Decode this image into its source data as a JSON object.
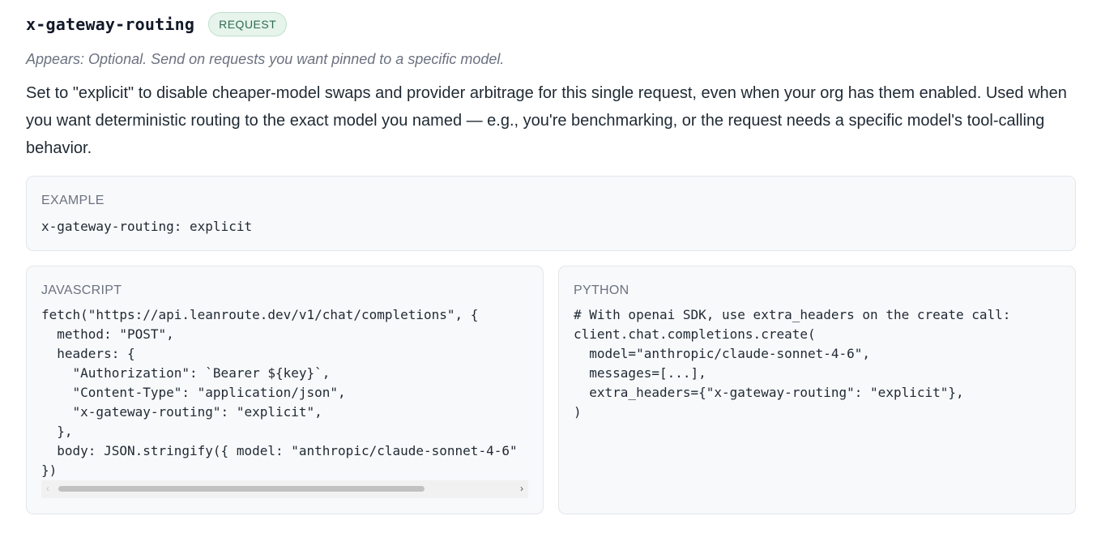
{
  "header": {
    "name": "x-gateway-routing",
    "badge": "REQUEST"
  },
  "appears": "Appears: Optional. Send on requests you want pinned to a specific model.",
  "description": "Set to \"explicit\" to disable cheaper-model swaps and provider arbitrage for this single request, even when your org has them enabled. Used when you want deterministic routing to the exact model you named — e.g., you're benchmarking, or the request needs a specific model's tool-calling behavior.",
  "example": {
    "label": "EXAMPLE",
    "code": "x-gateway-routing: explicit"
  },
  "javascript": {
    "label": "JAVASCRIPT",
    "lines": [
      "fetch(\"https://api.leanroute.dev/v1/chat/completions\", {",
      "  method: \"POST\",",
      "  headers: {",
      "    \"Authorization\": `Bearer ${key}`,",
      "    \"Content-Type\": \"application/json\",",
      "    \"x-gateway-routing\": \"explicit\",",
      "  },",
      "  body: JSON.stringify({ model: \"anthropic/claude-sonnet-4-6\"",
      "})"
    ]
  },
  "python": {
    "label": "PYTHON",
    "lines": [
      "# With openai SDK, use extra_headers on the create call:",
      "client.chat.completions.create(",
      "  model=\"anthropic/claude-sonnet-4-6\",",
      "  messages=[...],",
      "  extra_headers={\"x-gateway-routing\": \"explicit\"},",
      ")"
    ]
  },
  "icons": {
    "scroll_left": "chevron-left-icon",
    "scroll_right": "chevron-right-icon"
  },
  "colors": {
    "badge_text": "#2f6b4f",
    "badge_bg": "#e6f4ec",
    "box_bg": "#f8f9fb"
  }
}
